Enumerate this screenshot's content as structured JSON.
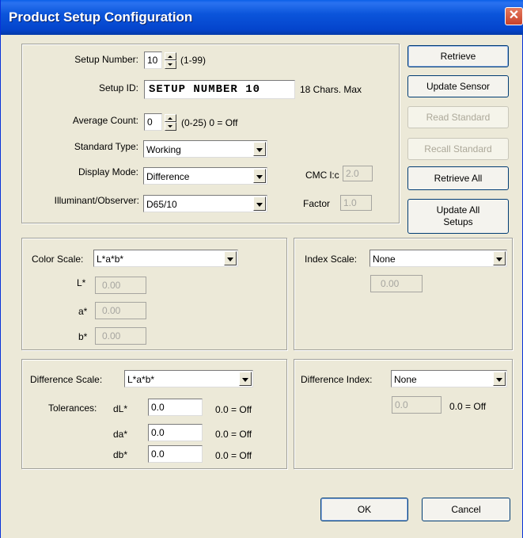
{
  "window": {
    "title": "Product Setup Configuration"
  },
  "icons": {
    "close": "close-icon",
    "combo_arrow": "chevron-down-icon",
    "spin": "spinner-arrows-icon"
  },
  "setup": {
    "setup_number_label": "Setup Number:",
    "setup_number_value": "10",
    "setup_number_range": "(1-99)",
    "setup_id_label": "Setup ID:",
    "setup_id_value": "SETUP NUMBER 10",
    "setup_id_hint": "18 Chars. Max",
    "average_count_label": "Average Count:",
    "average_count_value": "0",
    "average_count_range": "(0-25) 0 = Off",
    "standard_type_label": "Standard Type:",
    "standard_type_value": "Working",
    "display_mode_label": "Display Mode:",
    "display_mode_value": "Difference",
    "cmc_label": "CMC l:c",
    "cmc_value": "2.0",
    "illuminant_label": "Illuminant/Observer:",
    "illuminant_value": "D65/10",
    "factor_label": "Factor",
    "factor_value": "1.0"
  },
  "buttons": {
    "retrieve": "Retrieve",
    "update_sensor": "Update Sensor",
    "read_standard": "Read Standard",
    "recall_standard": "Recall Standard",
    "retrieve_all": "Retrieve All",
    "update_all_setups_1": "Update All",
    "update_all_setups_2": "Setups",
    "ok": "OK",
    "cancel": "Cancel"
  },
  "color_scale": {
    "label": "Color Scale:",
    "value": "L*a*b*",
    "L_label": "L*",
    "L_value": "0.00",
    "a_label": "a*",
    "a_value": "0.00",
    "b_label": "b*",
    "b_value": "0.00"
  },
  "index_scale": {
    "label": "Index Scale:",
    "value": "None",
    "field_value": "0.00"
  },
  "difference_scale": {
    "label": "Difference Scale:",
    "value": "L*a*b*",
    "tolerances_label": "Tolerances:",
    "dL_label": "dL*",
    "dL_value": "0.0",
    "dL_hint": "0.0 = Off",
    "da_label": "da*",
    "da_value": "0.0",
    "da_hint": "0.0 = Off",
    "db_label": "db*",
    "db_value": "0.0",
    "db_hint": "0.0 = Off"
  },
  "difference_index": {
    "label": "Difference Index:",
    "value": "None",
    "field_value": "0.0",
    "hint": "0.0 = Off"
  }
}
